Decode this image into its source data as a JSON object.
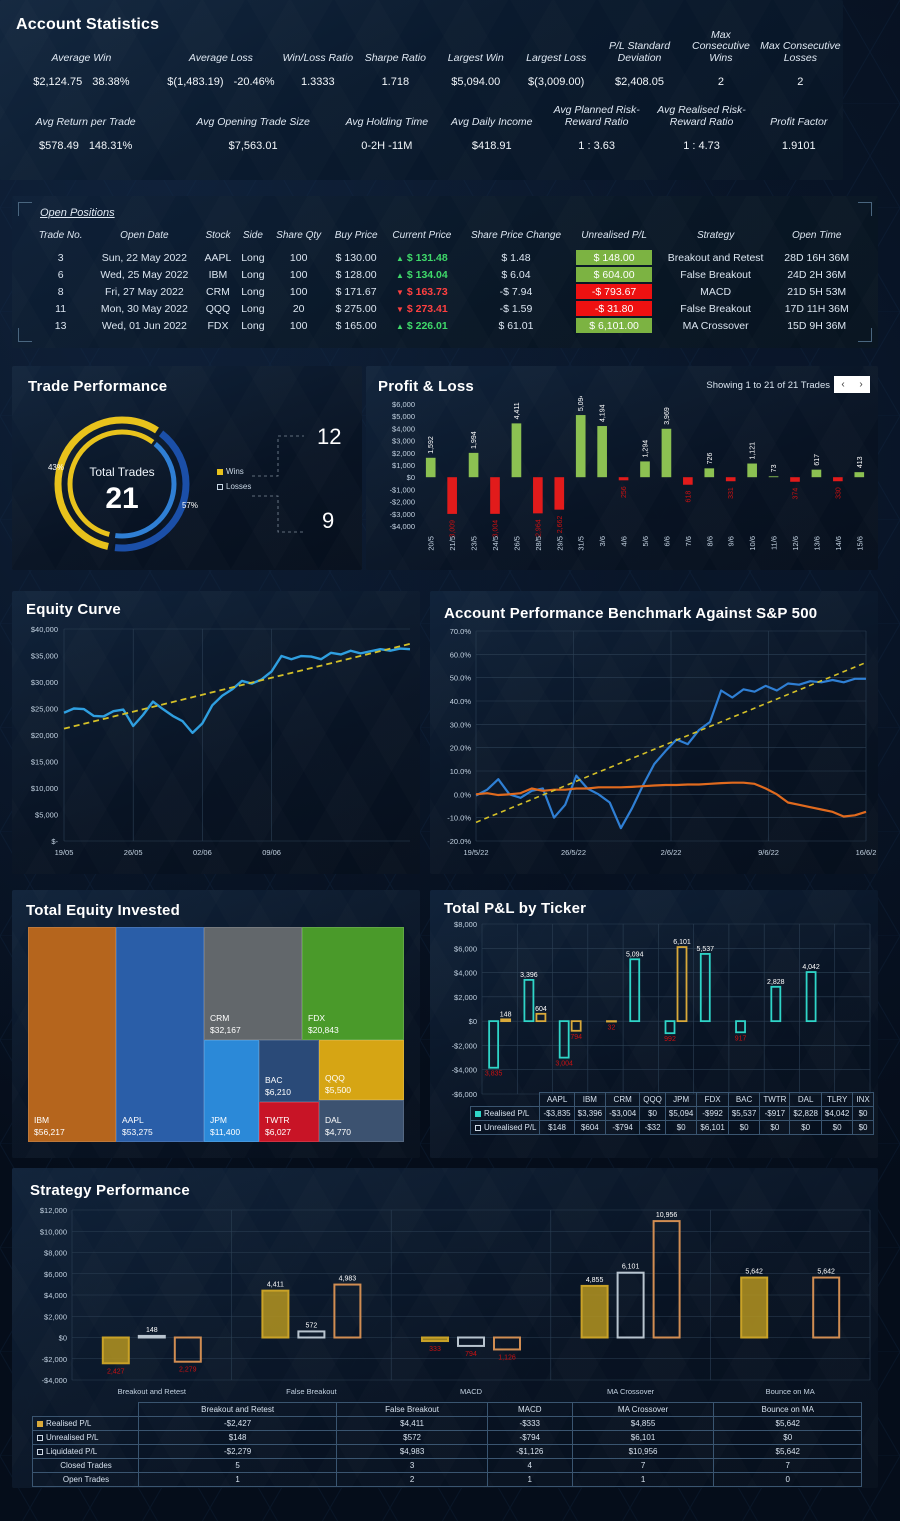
{
  "theme": {
    "bg": "#050d1a",
    "panel": "#0c1d33",
    "accent_blue": "#2f7fd4",
    "accent_gold": "#e8c21c",
    "green": "#7cb342",
    "red": "#ee1111",
    "teal": "#2fd5c8",
    "orange": "#d4702a"
  },
  "account_statistics": {
    "title": "Account Statistics",
    "row1": [
      {
        "label": "Average Win",
        "value": "$2,124.75",
        "value2": "38.38%"
      },
      {
        "label": "Average Loss",
        "value": "$(1,483.19)",
        "value2": "-20.46%"
      },
      {
        "label": "Win/Loss Ratio",
        "value": "1.3333"
      },
      {
        "label": "Sharpe Ratio",
        "value": "1.718"
      },
      {
        "label": "Largest Win",
        "value": "$5,094.00"
      },
      {
        "label": "Largest Loss",
        "value": "$(3,009.00)"
      },
      {
        "label": "P/L Standard Deviation",
        "value": "$2,408.05"
      },
      {
        "label": "Max Consecutive Wins",
        "value": "2"
      },
      {
        "label": "Max Consecutive Losses",
        "value": "2"
      }
    ],
    "row2": [
      {
        "label": "Avg Return per Trade",
        "value": "$578.49",
        "value2": "148.31%"
      },
      {
        "label": "Avg Opening Trade Size",
        "value": "$7,563.01"
      },
      {
        "label": "Avg Holding Time",
        "value": "0-2H  -11M"
      },
      {
        "label": "Avg Daily Income",
        "value": "$418.91"
      },
      {
        "label": "Avg Planned Risk-Reward Ratio",
        "value": "1 : 3.63"
      },
      {
        "label": "Avg Realised Risk-Reward Ratio",
        "value": "1 : 4.73"
      },
      {
        "label": "Profit Factor",
        "value": "1.9101"
      }
    ]
  },
  "open_positions": {
    "title": "Open Positions",
    "columns": [
      "Trade No.",
      "Open Date",
      "Stock",
      "Side",
      "Share Qty",
      "Buy Price",
      "Current Price",
      "Share Price Change",
      "Unrealised P/L",
      "Strategy",
      "Open Time"
    ],
    "rows": [
      {
        "no": "3",
        "date": "Sun, 22 May 2022",
        "stock": "AAPL",
        "side": "Long",
        "qty": "100",
        "buy": "$ 130.00",
        "dir": "up",
        "current": "$ 131.48",
        "change": "$ 1.48",
        "pl": "$ 148.00",
        "pl_state": "g",
        "strategy": "Breakout and Retest",
        "time": "28D 16H 36M"
      },
      {
        "no": "6",
        "date": "Wed, 25 May 2022",
        "stock": "IBM",
        "side": "Long",
        "qty": "100",
        "buy": "$ 128.00",
        "dir": "up",
        "current": "$ 134.04",
        "change": "$ 6.04",
        "pl": "$ 604.00",
        "pl_state": "g",
        "strategy": "False Breakout",
        "time": "24D 2H 36M"
      },
      {
        "no": "8",
        "date": "Fri, 27 May 2022",
        "stock": "CRM",
        "side": "Long",
        "qty": "100",
        "buy": "$ 171.67",
        "dir": "down",
        "current": "$ 163.73",
        "change": "-$ 7.94",
        "pl": "-$ 793.67",
        "pl_state": "r",
        "strategy": "MACD",
        "time": "21D 5H 53M"
      },
      {
        "no": "11",
        "date": "Mon, 30 May 2022",
        "stock": "QQQ",
        "side": "Long",
        "qty": "20",
        "buy": "$ 275.00",
        "dir": "down",
        "current": "$ 273.41",
        "change": "-$ 1.59",
        "pl": "-$ 31.80",
        "pl_state": "r",
        "strategy": "False Breakout",
        "time": "17D 11H 36M"
      },
      {
        "no": "13",
        "date": "Wed, 01 Jun 2022",
        "stock": "FDX",
        "side": "Long",
        "qty": "100",
        "buy": "$ 165.00",
        "dir": "up",
        "current": "$ 226.01",
        "change": "$ 61.01",
        "pl": "$ 6,101.00",
        "pl_state": "g",
        "strategy": "MA Crossover",
        "time": "15D 9H 36M"
      }
    ]
  },
  "trade_performance": {
    "title": "Trade Performance",
    "center_label": "Total Trades",
    "center_value": "21",
    "wins_pct": "57%",
    "losses_pct": "43%",
    "legend": [
      {
        "label": "Wins",
        "value": "12"
      },
      {
        "label": "Losses",
        "value": "9"
      }
    ],
    "chart_data": {
      "type": "pie",
      "title": "Trade Performance",
      "labels": [
        "Wins",
        "Losses"
      ],
      "values": [
        12,
        9
      ],
      "percent": [
        57,
        43
      ],
      "total": 21,
      "legend_position": "right"
    }
  },
  "profit_loss": {
    "title": "Profit & Loss",
    "showing": "Showing 1 to 21 of 21 Trades",
    "prev": "‹",
    "next": "›",
    "chart_data": {
      "type": "bar",
      "title": "Profit & Loss",
      "xlabel": "",
      "ylabel": "",
      "ylim": [
        -4000,
        6000
      ],
      "yticks": [
        "$6,000",
        "$5,000",
        "$4,000",
        "$3,000",
        "$2,000",
        "$1,000",
        "$0",
        "-$1,000",
        "-$2,000",
        "-$3,000",
        "-$4,000"
      ],
      "categories": [
        "20/5",
        "21/5",
        "23/5",
        "24/5",
        "26/5",
        "28/5",
        "29/5",
        "31/5",
        "3/6",
        "4/6",
        "5/6",
        "6/6",
        "7/6",
        "8/6",
        "9/6",
        "10/6",
        "11/6",
        "12/6",
        "13/6",
        "14/6",
        "15/6"
      ],
      "values": [
        1592,
        -3009,
        1994,
        -3004,
        4411,
        -2964,
        -2662,
        5094,
        4194,
        -256,
        1294,
        3969,
        -618,
        726,
        -331,
        1121,
        73,
        -374,
        617,
        -330,
        413
      ],
      "labels": [
        "1,592",
        "3,009",
        "1,994",
        "3,004",
        "4,411",
        "2,964",
        "2,662",
        "5,094",
        "4,194",
        "256",
        "1,294",
        "3,969",
        "618",
        "726",
        "331",
        "1,121",
        "73",
        "374",
        "617",
        "330",
        "413"
      ]
    }
  },
  "equity_curve": {
    "title": "Equity Curve",
    "chart_data": {
      "type": "line",
      "title": "Equity Curve",
      "ylim": [
        0,
        40000
      ],
      "yticks": [
        "$40,000",
        "$35,000",
        "$30,000",
        "$25,000",
        "$20,000",
        "$15,000",
        "$10,000",
        "$5,000",
        "$-"
      ],
      "xticks": [
        "19/05",
        "26/05",
        "02/06",
        "09/06"
      ],
      "series": [
        {
          "name": "Equity",
          "color": "#2f9fe0",
          "values": [
            24200,
            25000,
            24900,
            23600,
            23500,
            24500,
            24800,
            21700,
            23800,
            26300,
            24900,
            23600,
            22600,
            20400,
            22200,
            25600,
            27400,
            28600,
            30200,
            29700,
            30500,
            32000,
            34900,
            34300,
            34900,
            34800,
            34300,
            35500,
            35200,
            35900,
            35400,
            35800,
            36200,
            35900,
            36300,
            36200
          ]
        },
        {
          "name": "Trend",
          "color": "#d4c028",
          "dashed": true,
          "values": [
            21200,
            37200
          ]
        }
      ]
    }
  },
  "benchmark": {
    "title": "Account Performance Benchmark Against S&P 500",
    "chart_data": {
      "type": "line",
      "title": "Account Performance Benchmark Against S&P 500",
      "ylim": [
        -20,
        70
      ],
      "yticks": [
        "70.0%",
        "60.0%",
        "50.0%",
        "40.0%",
        "30.0%",
        "20.0%",
        "10.0%",
        "0.0%",
        "-10.0%",
        "-20.0%"
      ],
      "xticks": [
        "19/5/22",
        "26/5/22",
        "2/6/22",
        "9/6/22",
        "16/6/2"
      ],
      "series": [
        {
          "name": "Account",
          "color": "#2f7fd4",
          "values": [
            -0.5,
            2.0,
            6.5,
            0.0,
            -1.5,
            1.5,
            2.5,
            -10.0,
            -4.5,
            8.0,
            2.5,
            0.0,
            -3.5,
            -14.5,
            -6.0,
            4.0,
            13.0,
            18.5,
            23.5,
            21.5,
            27.5,
            31.0,
            44.5,
            41.5,
            45.0,
            44.0,
            46.5,
            44.5,
            47.5,
            47.0,
            48.5,
            48.0,
            49.0,
            48.0,
            49.5,
            49.5
          ]
        },
        {
          "name": "S&P 500",
          "color": "#e06a1e",
          "values": [
            0.0,
            0.5,
            -0.3,
            0.0,
            0.5,
            2.5,
            1.5,
            2.0,
            2.0,
            2.5,
            2.5,
            3.0,
            3.0,
            3.0,
            3.2,
            3.5,
            3.8,
            4.0,
            4.0,
            4.2,
            4.2,
            4.5,
            4.8,
            5.0,
            5.0,
            4.5,
            2.5,
            0.0,
            -3.5,
            -4.5,
            -5.5,
            -6.5,
            -7.5,
            -9.5,
            -9.0,
            -7.5
          ]
        },
        {
          "name": "Trend",
          "color": "#d4c028",
          "dashed": true,
          "values": [
            -12.0,
            56.5
          ]
        }
      ]
    }
  },
  "treemap": {
    "title": "Total Equity Invested",
    "chart_data": {
      "type": "treemap",
      "title": "Total Equity Invested",
      "items": [
        {
          "label": "IBM",
          "value": "$56,217",
          "amount": 56217,
          "color": "#b5651d"
        },
        {
          "label": "AAPL",
          "value": "$53,275",
          "amount": 53275,
          "color": "#2a5ea8"
        },
        {
          "label": "CRM",
          "value": "$32,167",
          "amount": 32167,
          "color": "#62676b"
        },
        {
          "label": "FDX",
          "value": "$20,843",
          "amount": 20843,
          "color": "#4a9a2a"
        },
        {
          "label": "JPM",
          "value": "$11,400",
          "amount": 11400,
          "color": "#2b89d8"
        },
        {
          "label": "BAC",
          "value": "$6,210",
          "amount": 6210,
          "color": "#2a4a78"
        },
        {
          "label": "TWTR",
          "value": "$6,027",
          "amount": 6027,
          "color": "#c81426"
        },
        {
          "label": "QQQ",
          "value": "$5,500",
          "amount": 5500,
          "color": "#d6a514"
        },
        {
          "label": "DAL",
          "value": "$4,770",
          "amount": 4770,
          "color": "#3c5270"
        }
      ]
    }
  },
  "ticker_pl": {
    "title": "Total P&L by Ticker",
    "legend": [
      {
        "label": "Realised P/L",
        "swatch": "sw-teal"
      },
      {
        "label": "Unrealised P/L",
        "swatch": "sw-none"
      }
    ],
    "chart_data": {
      "type": "bar",
      "title": "Total P&L by Ticker",
      "ylim": [
        -6000,
        8000
      ],
      "yticks": [
        "$8,000",
        "$6,000",
        "$4,000",
        "$2,000",
        "$0",
        "-$2,000",
        "-$4,000",
        "-$6,000"
      ],
      "categories": [
        "AAPL",
        "IBM",
        "CRM",
        "QQQ",
        "JPM",
        "FDX",
        "BAC",
        "TWTR",
        "DAL",
        "TLRY",
        "INX"
      ],
      "series": [
        {
          "name": "Realised P/L",
          "color": "#2fd5c8",
          "values": [
            -3835,
            3396,
            -3004,
            0,
            5094,
            -992,
            5537,
            -917,
            2828,
            4042,
            0
          ],
          "labels": [
            "-$3,835",
            "$3,396",
            "-$3,004",
            "$0",
            "$5,094",
            "-$992",
            "$5,537",
            "-$917",
            "$2,828",
            "$4,042",
            "$0"
          ]
        },
        {
          "name": "Unrealised P/L",
          "color": "#d9a93a",
          "values": [
            148,
            604,
            -794,
            -32,
            0,
            6101,
            0,
            0,
            0,
            0,
            0
          ],
          "labels": [
            "$148",
            "$604",
            "-$794",
            "-$32",
            "$0",
            "$6,101",
            "$0",
            "$0",
            "$0",
            "$0",
            "$0"
          ]
        }
      ]
    }
  },
  "strategy": {
    "title": "Strategy Performance",
    "chart_data": {
      "type": "bar",
      "title": "Strategy Performance",
      "ylim": [
        -4000,
        12000
      ],
      "yticks": [
        "$12,000",
        "$10,000",
        "$8,000",
        "$6,000",
        "$4,000",
        "$2,000",
        "$0",
        "-$2,000",
        "-$4,000"
      ],
      "categories": [
        "Breakout and Retest",
        "False Breakout",
        "MACD",
        "MA Crossover",
        "Bounce on MA"
      ],
      "series": [
        {
          "name": "Realised P/L",
          "color": "#c9a227",
          "values": [
            -2427,
            4411,
            -333,
            4855,
            5642
          ],
          "labels": [
            "-$2,427",
            "$4,411",
            "-$333",
            "$4,855",
            "$5,642"
          ]
        },
        {
          "name": "Unrealised P/L",
          "color": "#b8c4cf",
          "values": [
            148,
            572,
            -794,
            6101,
            0
          ],
          "labels": [
            "$148",
            "$572",
            "-$794",
            "$6,101",
            "$0"
          ]
        },
        {
          "name": "Liquidated P/L",
          "color": "#d18d52",
          "values": [
            -2279,
            4983,
            -1126,
            10956,
            5642
          ],
          "labels": [
            "-$2,279",
            "$4,983",
            "-$1,126",
            "$10,956",
            "$5,642"
          ]
        }
      ],
      "extra_rows": [
        {
          "name": "Closed Trades",
          "values": [
            "5",
            "3",
            "4",
            "7",
            "7"
          ]
        },
        {
          "name": "Open Trades",
          "values": [
            "1",
            "2",
            "1",
            "1",
            "0"
          ]
        }
      ]
    },
    "table_rows": [
      "Realised P/L",
      "Unrealised P/L",
      "Liquidated P/L",
      "Closed Trades",
      "Open Trades"
    ]
  }
}
